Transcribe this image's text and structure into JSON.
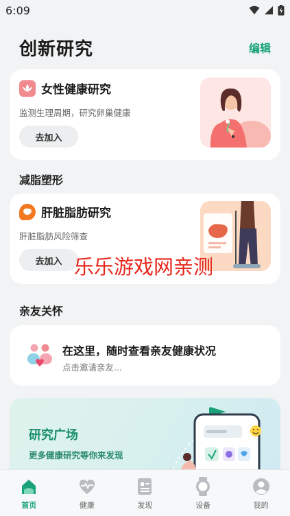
{
  "status": {
    "time": "6:09"
  },
  "header": {
    "title": "创新研究",
    "edit": "编辑"
  },
  "cards": [
    {
      "title": "女性健康研究",
      "subtitle": "监测生理周期，研究卵巢健康",
      "button": "去加入"
    },
    {
      "title": "肝脏脂肪研究",
      "subtitle": "肝脏脂肪风险筛查",
      "button": "去加入"
    }
  ],
  "sections": {
    "fat": "减脂塑形",
    "family": "亲友关怀"
  },
  "family": {
    "title": "在这里，随时查看亲友健康状况",
    "subtitle": "点击邀请亲友..."
  },
  "plaza": {
    "title": "研究广场",
    "subtitle": "更多健康研究等你来发现"
  },
  "watermark": "乐乐游戏网亲测",
  "tabs": [
    {
      "label": "首页",
      "icon": "home-icon"
    },
    {
      "label": "健康",
      "icon": "heart-pulse-icon"
    },
    {
      "label": "发现",
      "icon": "discover-icon"
    },
    {
      "label": "设备",
      "icon": "watch-icon"
    },
    {
      "label": "我的",
      "icon": "profile-icon"
    }
  ],
  "colors": {
    "accent": "#1aa37a",
    "watermark": "#e8261c",
    "pink": "#f08a8f",
    "orange": "#f2791f"
  }
}
